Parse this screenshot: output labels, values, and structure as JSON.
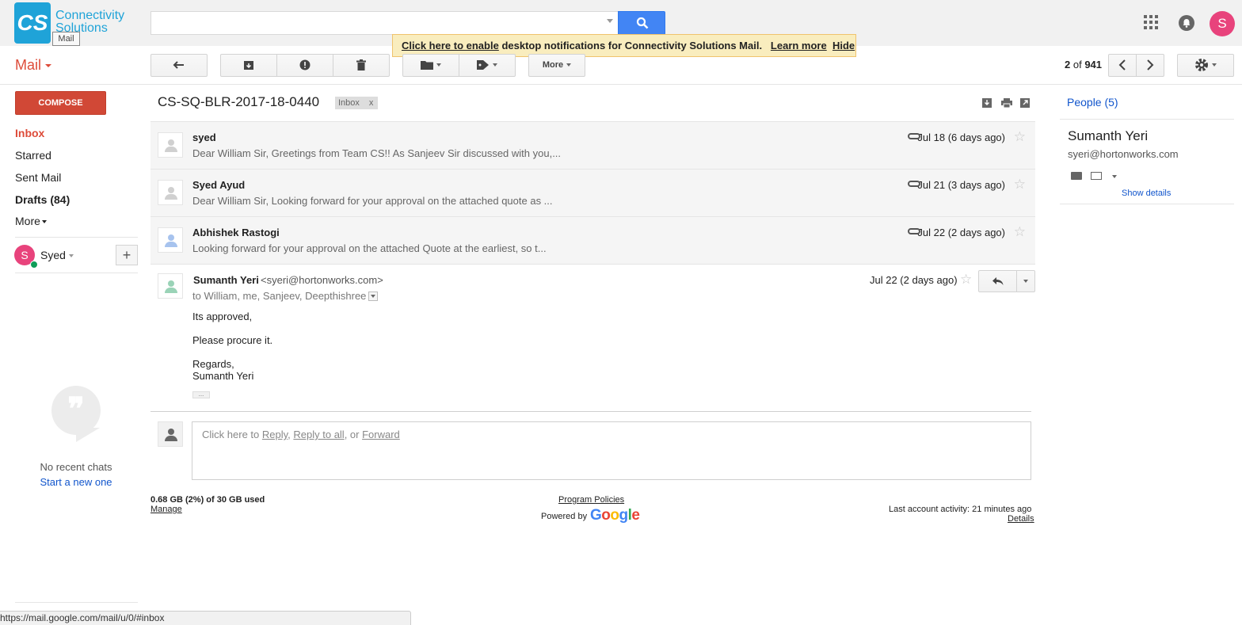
{
  "brand": {
    "logo_mark": "CS",
    "logo_line1": "Connectivity",
    "logo_line2": "Solutions",
    "tooltip": "Mail"
  },
  "search": {
    "value": "",
    "placeholder": ""
  },
  "notification": {
    "enable_link": "Click here to enable",
    "text": " desktop notifications for Connectivity Solutions Mail.",
    "learn_more": "Learn more",
    "hide": "Hide"
  },
  "account": {
    "avatar_letter": "S"
  },
  "app_label": "Mail",
  "toolbar": {
    "more_label": "More",
    "pager_current": "2",
    "pager_of": "of",
    "pager_total": "941"
  },
  "nav": {
    "compose": "COMPOSE",
    "inbox": "Inbox",
    "starred": "Starred",
    "sent": "Sent Mail",
    "drafts": "Drafts (84)",
    "more": "More"
  },
  "hangouts": {
    "avatar_letter": "S",
    "user_name": "Syed",
    "add_label": "+",
    "no_recent": "No recent chats",
    "start_new": "Start a new one"
  },
  "status_url": "https://mail.google.com/mail/u/0/#inbox",
  "thread": {
    "subject": "CS-SQ-BLR-2017-18-0440",
    "label": "Inbox",
    "label_remove": "x",
    "collapsed": [
      {
        "sender": "syed",
        "snippet": "Dear William Sir, Greetings from Team CS!! As Sanjeev Sir discussed with you,...",
        "date": "Jul 18 (6 days ago)"
      },
      {
        "sender": "Syed Ayud",
        "snippet": "Dear William Sir, Looking forward for your approval on the attached quote as ...",
        "date": "Jul 21 (3 days ago)"
      },
      {
        "sender": "Abhishek Rastogi",
        "snippet": "Looking forward for your approval on the attached Quote at the earliest, so t...",
        "date": "Jul 22 (2 days ago)"
      }
    ],
    "open": {
      "sender": "Sumanth Yeri",
      "email": "<syeri@hortonworks.com>",
      "to": "to William, me, Sanjeev, Deepthishree",
      "date": "Jul 22 (2 days ago)",
      "body": [
        "Its approved,",
        "Please procure it.",
        "Regards,",
        "Sumanth Yeri"
      ],
      "trim": "..."
    },
    "reply": {
      "prefix": "Click here to ",
      "reply": "Reply",
      "sep1": ", ",
      "reply_all": "Reply to all",
      "sep2": ", or ",
      "forward": "Forward"
    }
  },
  "footer": {
    "storage": "0.68 GB (2%) of 30 GB used",
    "manage": "Manage",
    "program_policies": "Program Policies",
    "powered_by": "Powered by",
    "google": [
      "G",
      "o",
      "o",
      "g",
      "l",
      "e"
    ],
    "google_colors": [
      "#4285f4",
      "#ea4335",
      "#fbbc05",
      "#4285f4",
      "#34a853",
      "#ea4335"
    ],
    "last_activity": "Last account activity: 21 minutes ago",
    "details": "Details"
  },
  "people": {
    "title": "People (5)",
    "name": "Sumanth Yeri",
    "email": "syeri@hortonworks.com",
    "show_details": "Show details"
  },
  "icons": {
    "star": "☆",
    "reply_arrow": "⤺"
  }
}
